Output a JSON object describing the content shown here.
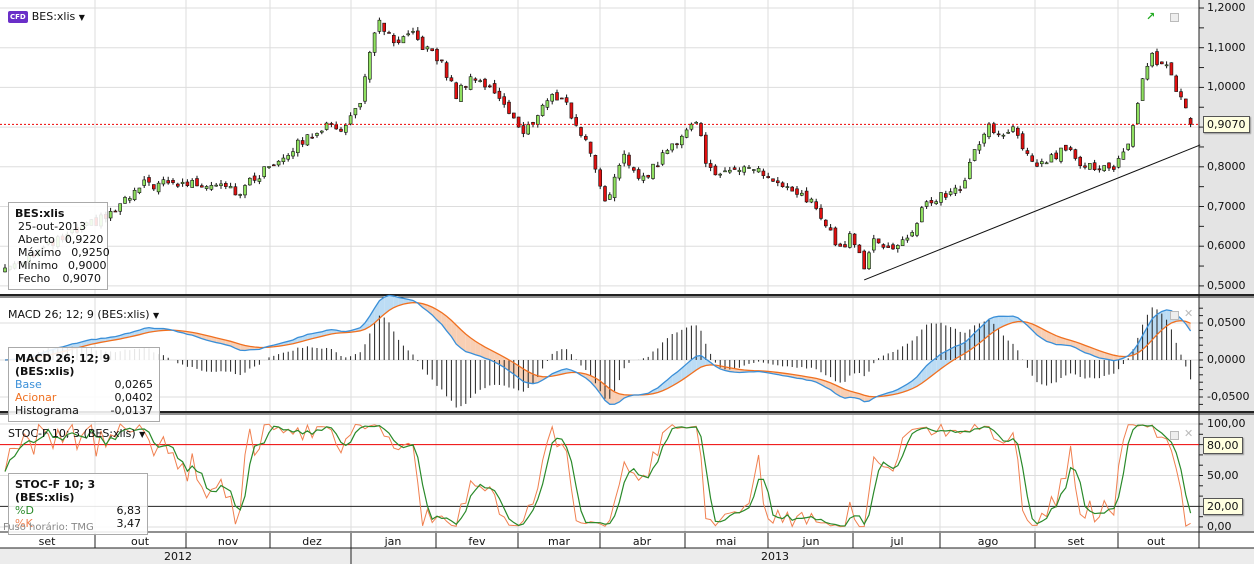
{
  "header": {
    "symbol": "BES:xlis",
    "badge": "CFD"
  },
  "ohlc_box": {
    "title": "BES:xlis",
    "date": "25-out-2013",
    "rows": [
      [
        "Aberto",
        "0,9220"
      ],
      [
        "Máximo",
        "0,9250"
      ],
      [
        "Mínimo",
        "0,9000"
      ],
      [
        "Fecho",
        "0,9070"
      ]
    ]
  },
  "macd_panel": {
    "title": "MACD 26; 12; 9 (BES:xlis)",
    "box_title": "MACD 26; 12; 9 (BES:xlis)",
    "rows": [
      [
        "Base",
        "0,0265"
      ],
      [
        "Acionar",
        "0,0402"
      ],
      [
        "Histograma",
        "-0,0137"
      ]
    ]
  },
  "stoch_panel": {
    "title": "STOC-F 10; 3 (BES:xlis)",
    "box_title": "STOC-F 10; 3 (BES:xlis)",
    "rows": [
      [
        "%D",
        "6,83"
      ],
      [
        "%K",
        "3,47"
      ]
    ]
  },
  "timezone": "Fuso horário: TMG",
  "colors": {
    "up": "#8fe060",
    "down": "#e01010",
    "base": "#3a8fd8",
    "signal": "#f07020",
    "d": "#2a8a2a",
    "k": "#f08050"
  },
  "chart_data": {
    "type": "candlestick",
    "symbol": "BES:xlis",
    "price_axis": {
      "ticks": [
        "1,2000",
        "1,1000",
        "1,0000",
        "0,9000",
        "0,8000",
        "0,7000",
        "0,6000",
        "0,5000"
      ],
      "values": [
        1.2,
        1.1,
        1.0,
        0.9,
        0.8,
        0.7,
        0.6,
        0.5
      ],
      "range": [
        0.5,
        1.2
      ]
    },
    "last_price": {
      "value": 0.907,
      "label": "0,9070"
    },
    "last_candle": {
      "open": 0.922,
      "high": 0.925,
      "low": 0.9,
      "close": 0.907
    },
    "trading_days": 248,
    "close_keypoints": [
      [
        0,
        0.545
      ],
      [
        22,
        0.68
      ],
      [
        29,
        0.755
      ],
      [
        47,
        0.76
      ],
      [
        48,
        0.73
      ],
      [
        57,
        0.82
      ],
      [
        66,
        0.9
      ],
      [
        71,
        0.9
      ],
      [
        74,
        0.97
      ],
      [
        77,
        1.13
      ],
      [
        78,
        1.17
      ],
      [
        81,
        1.105
      ],
      [
        85,
        1.13
      ],
      [
        91,
        1.06
      ],
      [
        94,
        0.98
      ],
      [
        97,
        1.03
      ],
      [
        103,
        0.98
      ],
      [
        108,
        0.88
      ],
      [
        113,
        0.97
      ],
      [
        116,
        0.98
      ],
      [
        119,
        0.905
      ],
      [
        122,
        0.84
      ],
      [
        125,
        0.715
      ],
      [
        129,
        0.82
      ],
      [
        133,
        0.77
      ],
      [
        138,
        0.84
      ],
      [
        144,
        0.92
      ],
      [
        146,
        0.82
      ],
      [
        149,
        0.77
      ],
      [
        152,
        0.805
      ],
      [
        157,
        0.79
      ],
      [
        164,
        0.73
      ],
      [
        168,
        0.715
      ],
      [
        172,
        0.63
      ],
      [
        174,
        0.59
      ],
      [
        176,
        0.63
      ],
      [
        179,
        0.55
      ],
      [
        181,
        0.63
      ],
      [
        184,
        0.59
      ],
      [
        188,
        0.615
      ],
      [
        191,
        0.69
      ],
      [
        195,
        0.73
      ],
      [
        199,
        0.74
      ],
      [
        202,
        0.84
      ],
      [
        205,
        0.905
      ],
      [
        208,
        0.87
      ],
      [
        210,
        0.895
      ],
      [
        214,
        0.805
      ],
      [
        218,
        0.82
      ],
      [
        222,
        0.855
      ],
      [
        224,
        0.81
      ],
      [
        231,
        0.79
      ],
      [
        233,
        0.83
      ],
      [
        235,
        0.905
      ],
      [
        237,
        1.02
      ],
      [
        239,
        1.08
      ],
      [
        242,
        1.045
      ],
      [
        245,
        0.97
      ],
      [
        247,
        0.907
      ]
    ],
    "trendline": [
      [
        179,
        0.515
      ],
      [
        249,
        0.855
      ]
    ],
    "macd_axis": {
      "ticks": [
        "0,0500",
        "0,0000",
        "-0,0500"
      ],
      "values": [
        0.05,
        0,
        -0.05
      ]
    },
    "stoch_axis": {
      "ticks": [
        "100,00",
        "50,00",
        "0,00"
      ],
      "values": [
        100,
        50,
        0
      ],
      "levels": [
        {
          "value": 80,
          "label": "80,00"
        },
        {
          "value": 20,
          "label": "20,00"
        }
      ]
    },
    "months": [
      "set",
      "out",
      "nov",
      "dez",
      "jan",
      "fev",
      "mar",
      "abr",
      "mai",
      "jun",
      "jul",
      "ago",
      "set",
      "out"
    ],
    "years": [
      "2012",
      "2013"
    ]
  }
}
